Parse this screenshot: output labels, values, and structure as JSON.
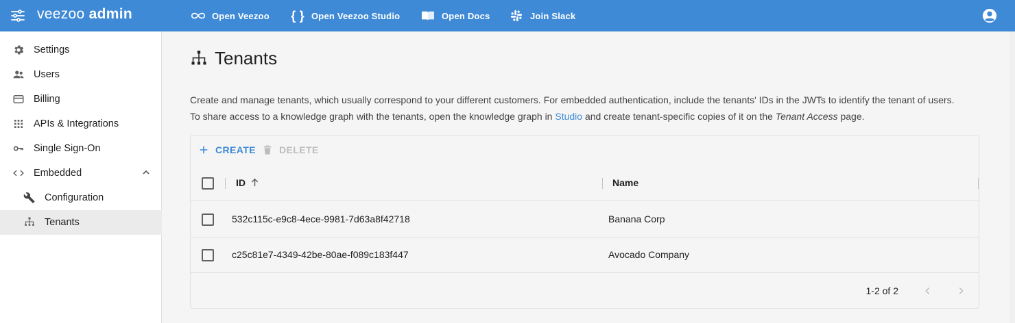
{
  "topbar": {
    "brand_light": "veezoo",
    "brand_bold": "admin",
    "links": [
      {
        "label": "Open Veezoo",
        "icon": "infinity-icon"
      },
      {
        "label": "Open Veezoo Studio",
        "icon": "braces-icon"
      },
      {
        "label": "Open Docs",
        "icon": "book-icon"
      },
      {
        "label": "Join Slack",
        "icon": "slack-icon"
      }
    ],
    "bg_color": "#3f8ad6"
  },
  "sidebar": {
    "items": [
      {
        "label": "Settings",
        "icon": "gear-icon"
      },
      {
        "label": "Users",
        "icon": "people-icon"
      },
      {
        "label": "Billing",
        "icon": "credit-card-icon"
      },
      {
        "label": "APIs & Integrations",
        "icon": "grid-apps-icon"
      },
      {
        "label": "Single Sign-On",
        "icon": "key-icon"
      },
      {
        "label": "Embedded",
        "icon": "code-icon",
        "expanded": true
      },
      {
        "label": "Configuration",
        "icon": "wrench-icon"
      },
      {
        "label": "Tenants",
        "icon": "sitemap-icon",
        "active": true
      }
    ]
  },
  "main": {
    "title": "Tenants",
    "desc_line1": "Create and manage tenants, which usually correspond to your different customers. For embedded authentication, include the tenants' IDs in the JWTs to identify the tenant of users.",
    "desc_line2_pre": "To share access to a knowledge graph with the tenants, open the knowledge graph in ",
    "desc_link": "Studio",
    "desc_line2_mid": " and create tenant-specific copies of it on the ",
    "desc_em": "Tenant Access",
    "desc_line2_post": " page.",
    "toolbar": {
      "create_label": "CREATE",
      "delete_label": "DELETE"
    },
    "table": {
      "columns": [
        "ID",
        "Name"
      ],
      "rows": [
        {
          "id": "532c115c-e9c8-4ece-9981-7d63a8f42718",
          "name": "Banana Corp"
        },
        {
          "id": "c25c81e7-4349-42be-80ae-f089c183f447",
          "name": "Avocado Company"
        }
      ],
      "pagination": "1-2 of 2"
    }
  }
}
